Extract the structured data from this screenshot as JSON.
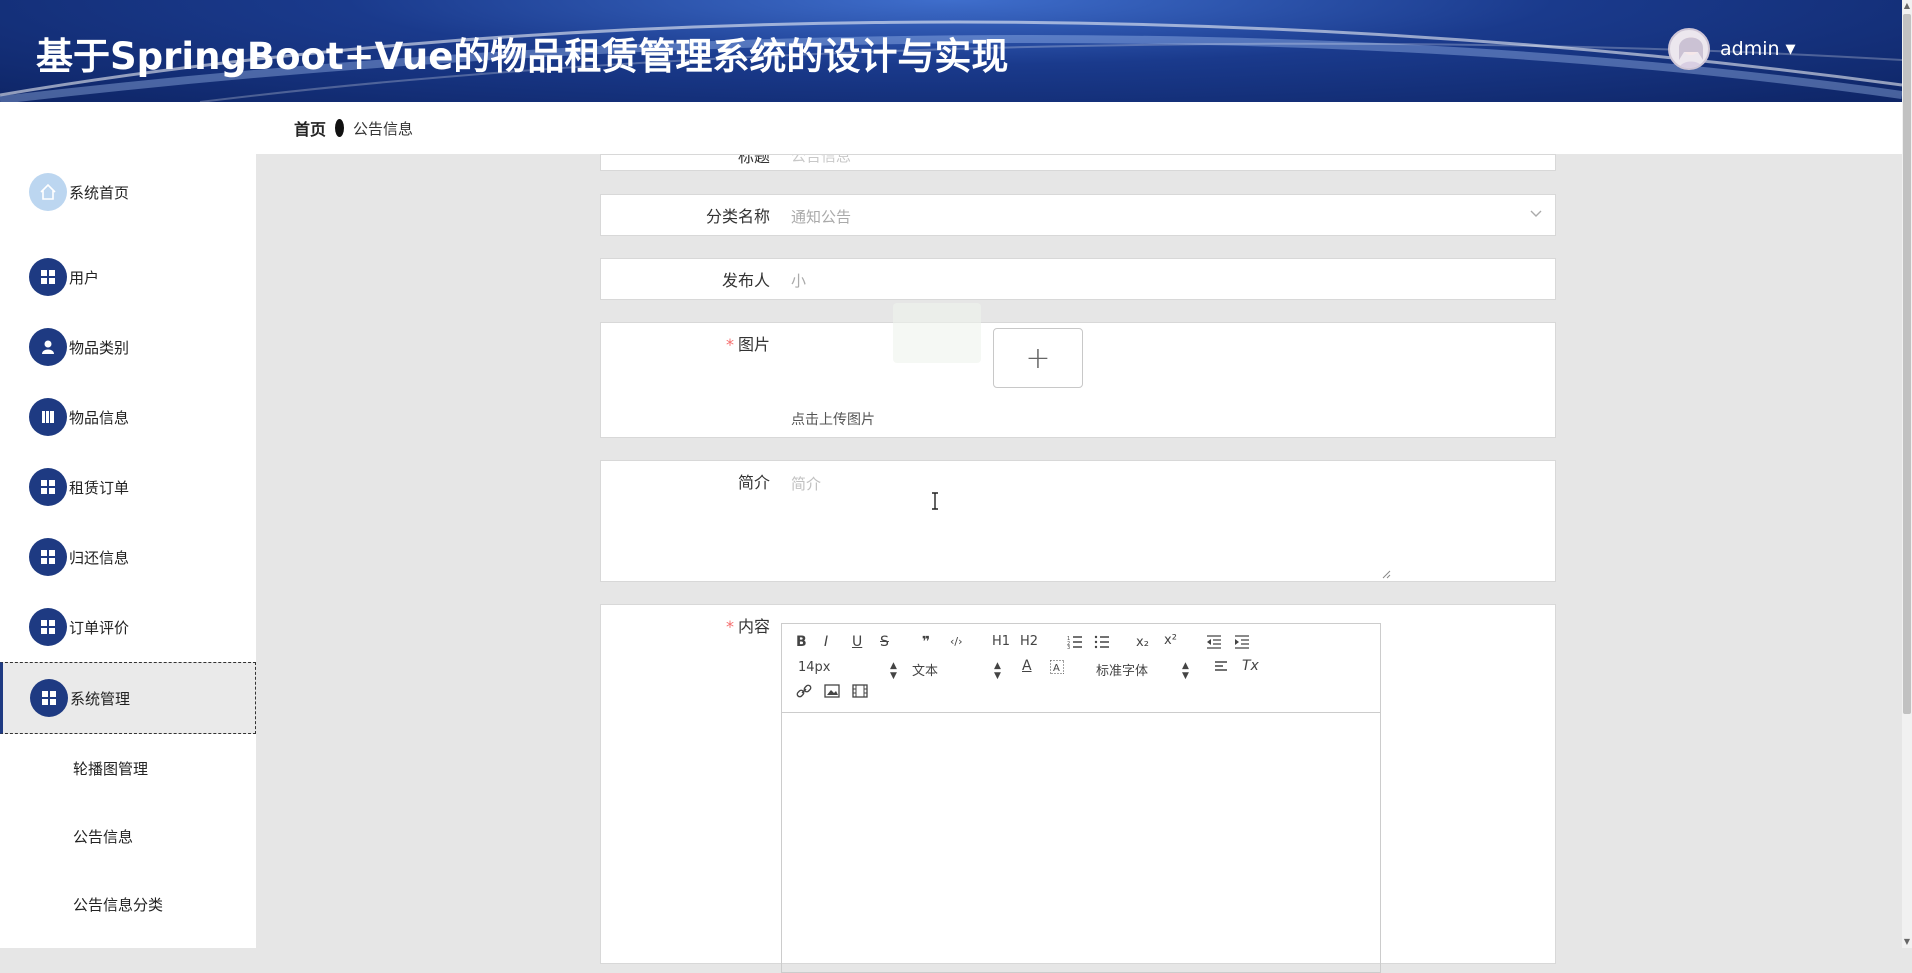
{
  "header": {
    "title": "基于SpringBoot+Vue的物品租赁管理系统的设计与实现",
    "username": "admin",
    "caret": "▼"
  },
  "sidebar": {
    "items": [
      {
        "label": "系统首页",
        "icon": "home-icon"
      },
      {
        "label": "用户",
        "icon": "grid-icon"
      },
      {
        "label": "物品类别",
        "icon": "user-icon"
      },
      {
        "label": "物品信息",
        "icon": "book-icon"
      },
      {
        "label": "租赁订单",
        "icon": "grid-icon"
      },
      {
        "label": "归还信息",
        "icon": "grid-icon"
      },
      {
        "label": "订单评价",
        "icon": "grid-icon"
      },
      {
        "label": "系统管理",
        "icon": "grid-icon"
      }
    ],
    "sub_items": [
      "轮播图管理",
      "公告信息",
      "公告信息分类"
    ]
  },
  "breadcrumb": {
    "home": "首页",
    "current": "公告信息"
  },
  "form": {
    "title_row": {
      "label": "标题",
      "value": "公告信息"
    },
    "category": {
      "label": "分类名称",
      "value": "通知公告"
    },
    "publisher": {
      "label": "发布人",
      "value": "小"
    },
    "image": {
      "label": "图片",
      "required_mark": "*",
      "upload_icon": "+",
      "hint": "点击上传图片"
    },
    "intro": {
      "label": "简介",
      "placeholder": "简介"
    },
    "content": {
      "label": "内容",
      "required_mark": "*"
    }
  },
  "editor_toolbar": {
    "bold": "B",
    "italic": "I",
    "underline": "U",
    "strike": "S",
    "quote": "❞",
    "code": "‹/›",
    "h1": "H1",
    "h2": "H2",
    "size": "14px",
    "text_style": "文本",
    "font": "标准字体",
    "font_color": "A",
    "subscript": "x₂",
    "superscript": "x²",
    "clear_format": "Tx"
  }
}
